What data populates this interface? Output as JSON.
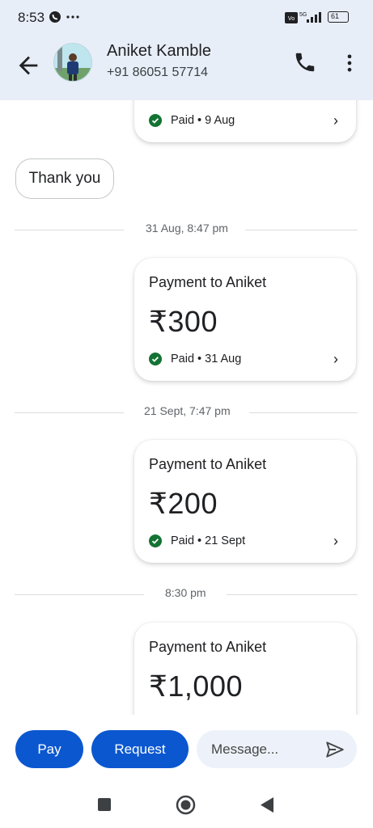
{
  "status_bar": {
    "time": "8:53",
    "battery": "61",
    "network": "5G"
  },
  "header": {
    "contact_name": "Aniket Kamble",
    "contact_phone": "+91 86051 57714"
  },
  "chat": {
    "partial_card": {
      "status": "Paid • 9 Aug",
      "chevron": "›"
    },
    "thank_you": "Thank you",
    "separators": [
      "31 Aug, 8:47 pm",
      "21 Sept, 7:47 pm",
      "8:30 pm"
    ],
    "payments": [
      {
        "title": "Payment to Aniket",
        "amount": "₹300",
        "status": "Paid • 31 Aug",
        "chevron": "›"
      },
      {
        "title": "Payment to Aniket",
        "amount": "₹200",
        "status": "Paid • 21 Sept",
        "chevron": "›"
      },
      {
        "title": "Payment to Aniket",
        "amount": "₹1,000"
      }
    ]
  },
  "composer": {
    "pay_label": "Pay",
    "request_label": "Request",
    "message_placeholder": "Message..."
  },
  "colors": {
    "accent": "#0b57d0",
    "header_bg": "#e8eef8",
    "paid_green": "#137333"
  }
}
